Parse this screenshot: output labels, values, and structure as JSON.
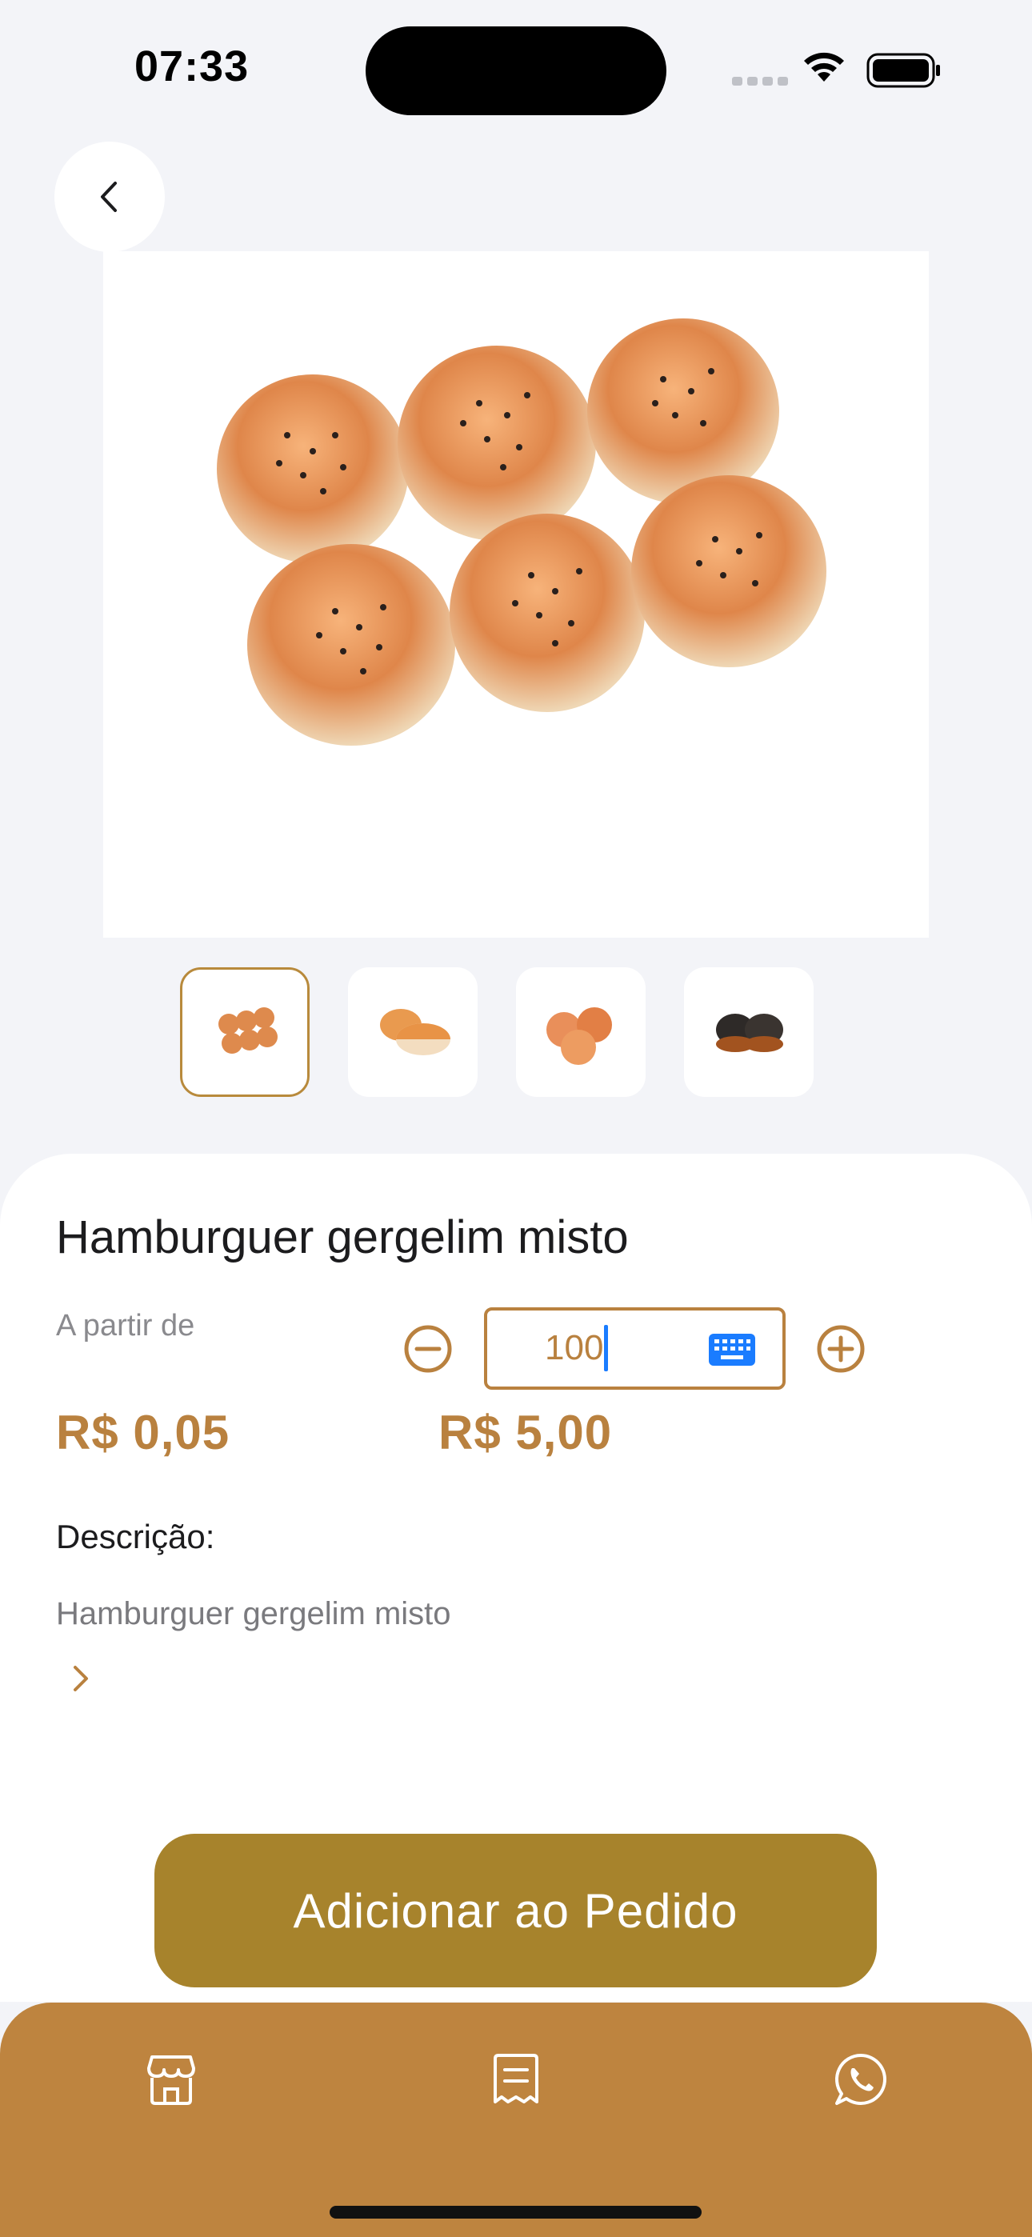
{
  "status_bar": {
    "time": "07:33"
  },
  "product": {
    "title": "Hamburguer gergelim misto",
    "price_from_label": "A partir de",
    "unit_price": "R$ 0,05",
    "total_price": "R$ 5,00",
    "quantity": "100",
    "description_label": "Descrição:",
    "description": "Hamburguer gergelim misto"
  },
  "thumbnails": [
    {
      "name": "six-buns",
      "selected": true
    },
    {
      "name": "bun-split",
      "selected": false
    },
    {
      "name": "three-buns",
      "selected": false
    },
    {
      "name": "dark-buns",
      "selected": false
    }
  ],
  "cta": {
    "label": "Adicionar ao Pedido"
  },
  "tab_bar": {
    "items": [
      {
        "icon": "store-icon"
      },
      {
        "icon": "receipt-icon"
      },
      {
        "icon": "whatsapp-icon"
      }
    ]
  },
  "colors": {
    "accent": "#b9813f",
    "button": "#a7832c",
    "tab_bar": "#be843f",
    "background": "#f3f4f8"
  }
}
